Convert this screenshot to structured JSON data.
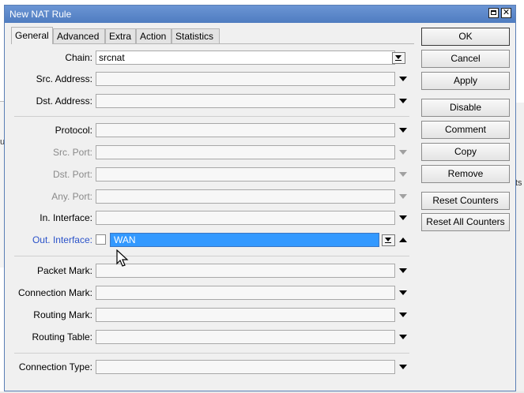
{
  "background": {
    "fragment_left": "ul",
    "fragment_right": "ts"
  },
  "dialog": {
    "title": "New NAT Rule"
  },
  "tabs": [
    {
      "label": "General"
    },
    {
      "label": "Advanced"
    },
    {
      "label": "Extra"
    },
    {
      "label": "Action"
    },
    {
      "label": "Statistics"
    }
  ],
  "fields": {
    "chain": {
      "label": "Chain:",
      "value": "srcnat"
    },
    "src_address": {
      "label": "Src. Address:",
      "value": ""
    },
    "dst_address": {
      "label": "Dst. Address:",
      "value": ""
    },
    "protocol": {
      "label": "Protocol:",
      "value": ""
    },
    "src_port": {
      "label": "Src. Port:",
      "value": ""
    },
    "dst_port": {
      "label": "Dst. Port:",
      "value": ""
    },
    "any_port": {
      "label": "Any. Port:",
      "value": ""
    },
    "in_interface": {
      "label": "In. Interface:",
      "value": ""
    },
    "out_interface": {
      "label": "Out. Interface:",
      "value": "WAN"
    },
    "packet_mark": {
      "label": "Packet Mark:",
      "value": ""
    },
    "connection_mark": {
      "label": "Connection Mark:",
      "value": ""
    },
    "routing_mark": {
      "label": "Routing Mark:",
      "value": ""
    },
    "routing_table": {
      "label": "Routing Table:",
      "value": ""
    },
    "connection_type": {
      "label": "Connection Type:",
      "value": ""
    }
  },
  "buttons": {
    "ok": "OK",
    "cancel": "Cancel",
    "apply": "Apply",
    "disable": "Disable",
    "comment": "Comment",
    "copy": "Copy",
    "remove": "Remove",
    "reset_counters": "Reset Counters",
    "reset_all_counters": "Reset All Counters"
  },
  "colors": {
    "titlebar": "#5b86c7",
    "selection": "#3399ff",
    "out_interface_label": "#2a52c9"
  }
}
